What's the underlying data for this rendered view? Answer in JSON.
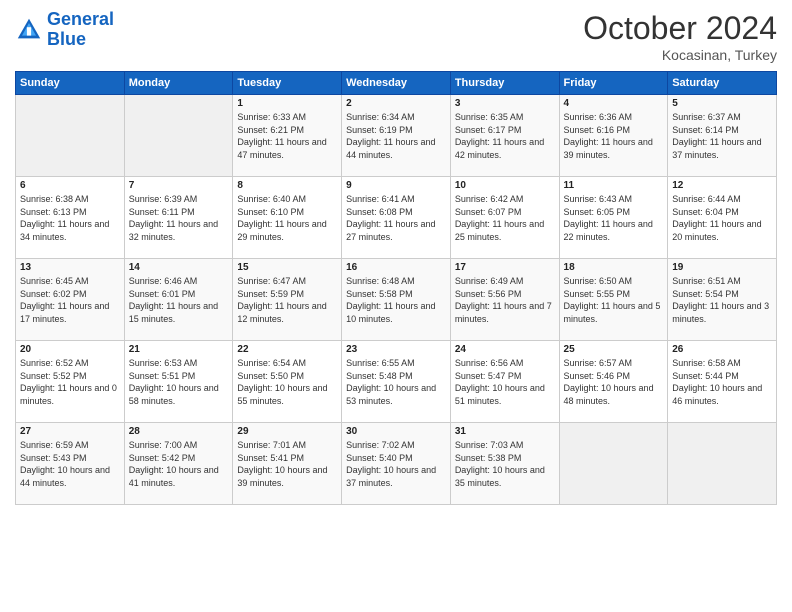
{
  "header": {
    "logo_line1": "General",
    "logo_line2": "Blue",
    "month": "October 2024",
    "location": "Kocasinan, Turkey"
  },
  "days_of_week": [
    "Sunday",
    "Monday",
    "Tuesday",
    "Wednesday",
    "Thursday",
    "Friday",
    "Saturday"
  ],
  "weeks": [
    [
      {
        "day": "",
        "info": ""
      },
      {
        "day": "",
        "info": ""
      },
      {
        "day": "1",
        "info": "Sunrise: 6:33 AM\nSunset: 6:21 PM\nDaylight: 11 hours and 47 minutes."
      },
      {
        "day": "2",
        "info": "Sunrise: 6:34 AM\nSunset: 6:19 PM\nDaylight: 11 hours and 44 minutes."
      },
      {
        "day": "3",
        "info": "Sunrise: 6:35 AM\nSunset: 6:17 PM\nDaylight: 11 hours and 42 minutes."
      },
      {
        "day": "4",
        "info": "Sunrise: 6:36 AM\nSunset: 6:16 PM\nDaylight: 11 hours and 39 minutes."
      },
      {
        "day": "5",
        "info": "Sunrise: 6:37 AM\nSunset: 6:14 PM\nDaylight: 11 hours and 37 minutes."
      }
    ],
    [
      {
        "day": "6",
        "info": "Sunrise: 6:38 AM\nSunset: 6:13 PM\nDaylight: 11 hours and 34 minutes."
      },
      {
        "day": "7",
        "info": "Sunrise: 6:39 AM\nSunset: 6:11 PM\nDaylight: 11 hours and 32 minutes."
      },
      {
        "day": "8",
        "info": "Sunrise: 6:40 AM\nSunset: 6:10 PM\nDaylight: 11 hours and 29 minutes."
      },
      {
        "day": "9",
        "info": "Sunrise: 6:41 AM\nSunset: 6:08 PM\nDaylight: 11 hours and 27 minutes."
      },
      {
        "day": "10",
        "info": "Sunrise: 6:42 AM\nSunset: 6:07 PM\nDaylight: 11 hours and 25 minutes."
      },
      {
        "day": "11",
        "info": "Sunrise: 6:43 AM\nSunset: 6:05 PM\nDaylight: 11 hours and 22 minutes."
      },
      {
        "day": "12",
        "info": "Sunrise: 6:44 AM\nSunset: 6:04 PM\nDaylight: 11 hours and 20 minutes."
      }
    ],
    [
      {
        "day": "13",
        "info": "Sunrise: 6:45 AM\nSunset: 6:02 PM\nDaylight: 11 hours and 17 minutes."
      },
      {
        "day": "14",
        "info": "Sunrise: 6:46 AM\nSunset: 6:01 PM\nDaylight: 11 hours and 15 minutes."
      },
      {
        "day": "15",
        "info": "Sunrise: 6:47 AM\nSunset: 5:59 PM\nDaylight: 11 hours and 12 minutes."
      },
      {
        "day": "16",
        "info": "Sunrise: 6:48 AM\nSunset: 5:58 PM\nDaylight: 11 hours and 10 minutes."
      },
      {
        "day": "17",
        "info": "Sunrise: 6:49 AM\nSunset: 5:56 PM\nDaylight: 11 hours and 7 minutes."
      },
      {
        "day": "18",
        "info": "Sunrise: 6:50 AM\nSunset: 5:55 PM\nDaylight: 11 hours and 5 minutes."
      },
      {
        "day": "19",
        "info": "Sunrise: 6:51 AM\nSunset: 5:54 PM\nDaylight: 11 hours and 3 minutes."
      }
    ],
    [
      {
        "day": "20",
        "info": "Sunrise: 6:52 AM\nSunset: 5:52 PM\nDaylight: 11 hours and 0 minutes."
      },
      {
        "day": "21",
        "info": "Sunrise: 6:53 AM\nSunset: 5:51 PM\nDaylight: 10 hours and 58 minutes."
      },
      {
        "day": "22",
        "info": "Sunrise: 6:54 AM\nSunset: 5:50 PM\nDaylight: 10 hours and 55 minutes."
      },
      {
        "day": "23",
        "info": "Sunrise: 6:55 AM\nSunset: 5:48 PM\nDaylight: 10 hours and 53 minutes."
      },
      {
        "day": "24",
        "info": "Sunrise: 6:56 AM\nSunset: 5:47 PM\nDaylight: 10 hours and 51 minutes."
      },
      {
        "day": "25",
        "info": "Sunrise: 6:57 AM\nSunset: 5:46 PM\nDaylight: 10 hours and 48 minutes."
      },
      {
        "day": "26",
        "info": "Sunrise: 6:58 AM\nSunset: 5:44 PM\nDaylight: 10 hours and 46 minutes."
      }
    ],
    [
      {
        "day": "27",
        "info": "Sunrise: 6:59 AM\nSunset: 5:43 PM\nDaylight: 10 hours and 44 minutes."
      },
      {
        "day": "28",
        "info": "Sunrise: 7:00 AM\nSunset: 5:42 PM\nDaylight: 10 hours and 41 minutes."
      },
      {
        "day": "29",
        "info": "Sunrise: 7:01 AM\nSunset: 5:41 PM\nDaylight: 10 hours and 39 minutes."
      },
      {
        "day": "30",
        "info": "Sunrise: 7:02 AM\nSunset: 5:40 PM\nDaylight: 10 hours and 37 minutes."
      },
      {
        "day": "31",
        "info": "Sunrise: 7:03 AM\nSunset: 5:38 PM\nDaylight: 10 hours and 35 minutes."
      },
      {
        "day": "",
        "info": ""
      },
      {
        "day": "",
        "info": ""
      }
    ]
  ]
}
